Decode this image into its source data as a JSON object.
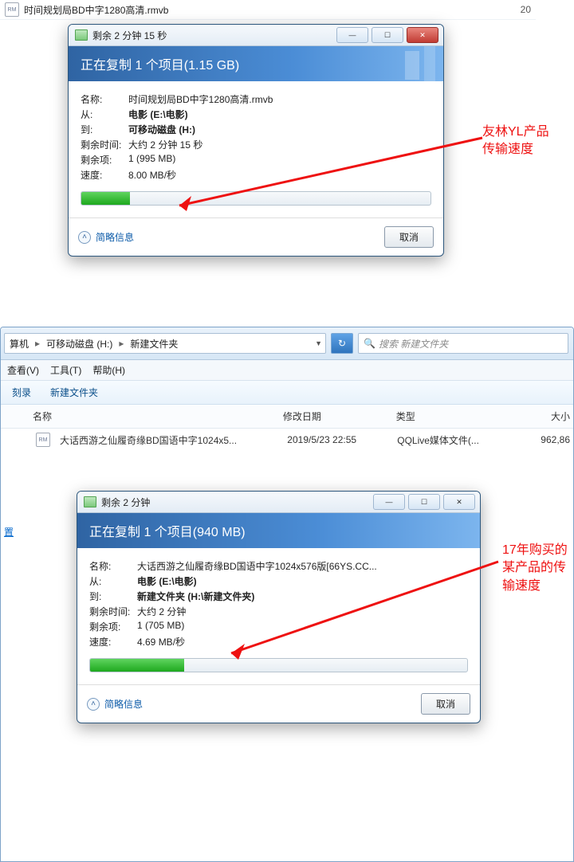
{
  "topFile": {
    "name": "时间规划局BD中字1280高清.rmvb",
    "dateFragment": "20"
  },
  "dialog1": {
    "title": "剩余 2 分钟 15 秒",
    "header": "正在复制 1 个项目(1.15 GB)",
    "labels": {
      "name": "名称:",
      "from": "从:",
      "to": "到:",
      "remainTime": "剩余时间:",
      "remainItem": "剩余项:",
      "speed": "速度:"
    },
    "values": {
      "name": "时间规划局BD中字1280高清.rmvb",
      "from": "电影 (E:\\电影)",
      "to": "可移动磁盘 (H:)",
      "remainTime": "大约 2 分钟 15 秒",
      "remainItem": "1 (995 MB)",
      "speed": "8.00 MB/秒"
    },
    "moreInfo": "简略信息",
    "cancel": "取消",
    "progressPct": 14
  },
  "annotation1": "友林YL产品\n传输速度",
  "explorer": {
    "crumbComputer": "算机",
    "crumbDisk": "可移动磁盘 (H:)",
    "crumbFolder": "新建文件夹",
    "searchPlaceholder": "搜索 新建文件夹",
    "menu": {
      "view": "查看(V)",
      "tools": "工具(T)",
      "help": "帮助(H)"
    },
    "toolbar": {
      "burn": "刻录",
      "newFolder": "新建文件夹"
    },
    "cols": {
      "name": "名称",
      "date": "修改日期",
      "type": "类型",
      "size": "大小"
    },
    "sidebar": {
      "device": "置"
    },
    "file": {
      "name": "大话西游之仙履奇缘BD国语中字1024x5...",
      "date": "2019/5/23 22:55",
      "type": "QQLive媒体文件(...",
      "size": "962,86"
    }
  },
  "dialog2": {
    "title": "剩余 2 分钟",
    "header": "正在复制 1 个项目(940 MB)",
    "labels": {
      "name": "名称:",
      "from": "从:",
      "to": "到:",
      "remainTime": "剩余时间:",
      "remainItem": "剩余项:",
      "speed": "速度:"
    },
    "values": {
      "name": "大话西游之仙履奇缘BD国语中字1024x576版[66YS.CC...",
      "from": "电影 (E:\\电影)",
      "to": "新建文件夹 (H:\\新建文件夹)",
      "remainTime": "大约 2 分钟",
      "remainItem": "1 (705 MB)",
      "speed": "4.69 MB/秒"
    },
    "moreInfo": "简略信息",
    "cancel": "取消",
    "progressPct": 25
  },
  "annotation2": "17年购买的某产品的传输速度"
}
